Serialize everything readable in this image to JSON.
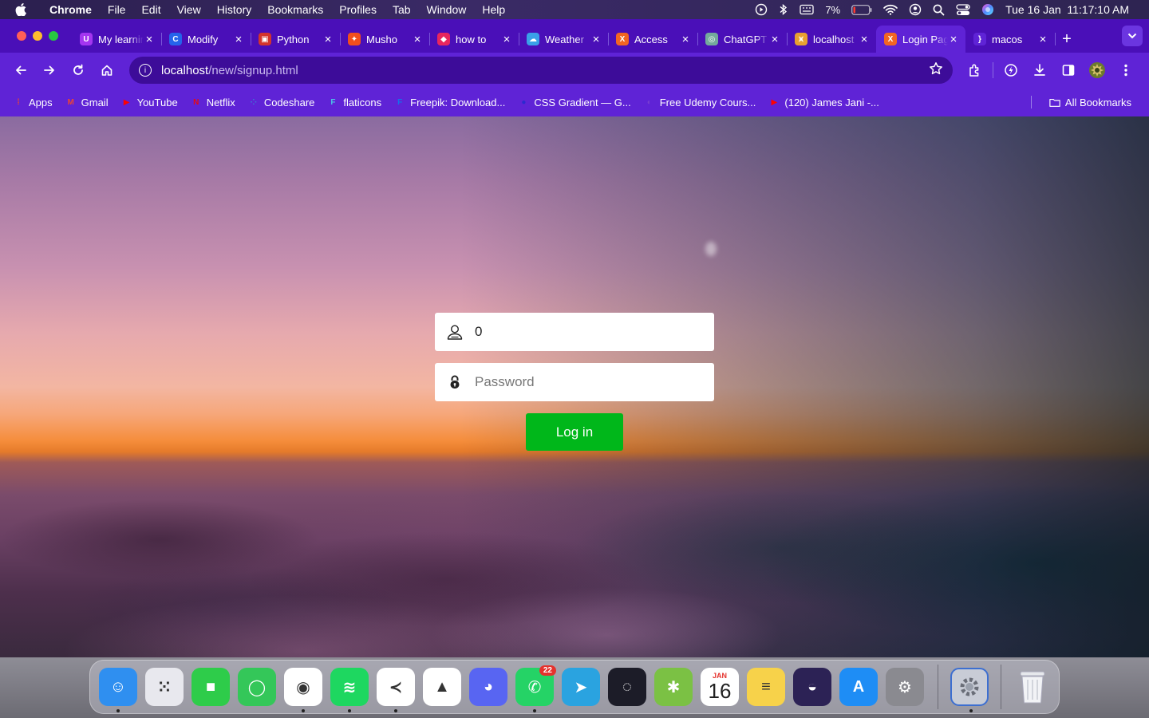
{
  "menubar": {
    "app_name": "Chrome",
    "items": [
      "File",
      "Edit",
      "View",
      "History",
      "Bookmarks",
      "Profiles",
      "Tab",
      "Window",
      "Help"
    ],
    "battery": "7%",
    "clock": "Tue 16 Jan  11:17:10 AM"
  },
  "tabs": [
    {
      "title": "My learning",
      "favicon_color": "#a435f0",
      "favicon_glyph": "U"
    },
    {
      "title": "Modify",
      "favicon_color": "#2563eb",
      "favicon_glyph": "C"
    },
    {
      "title": "Python",
      "favicon_color": "#d4342c",
      "favicon_glyph": "▣"
    },
    {
      "title": "Musho",
      "favicon_color": "#f24e1e",
      "favicon_glyph": "✦"
    },
    {
      "title": "how to",
      "favicon_color": "#e8265e",
      "favicon_glyph": "◆"
    },
    {
      "title": "Weather",
      "favicon_color": "#3aa0e8",
      "favicon_glyph": "☁"
    },
    {
      "title": "Access",
      "favicon_color": "#f26522",
      "favicon_glyph": "X"
    },
    {
      "title": "ChatGPT",
      "favicon_color": "#74aa9c",
      "favicon_glyph": "◎"
    },
    {
      "title": "localhost",
      "favicon_color": "#e8a030",
      "favicon_glyph": "⩙"
    },
    {
      "title": "Login Page",
      "favicon_color": "#f26522",
      "favicon_glyph": "X",
      "active": true
    },
    {
      "title": "macos",
      "favicon_color": "#5f23d6",
      "favicon_glyph": "}"
    }
  ],
  "address_bar": {
    "host": "localhost",
    "path": "/new/signup.html"
  },
  "bookmarks": [
    {
      "label": "Apps",
      "icon_color": "#ea4335",
      "glyph": "⁞"
    },
    {
      "label": "Gmail",
      "icon_color": "#ea4335",
      "glyph": "M"
    },
    {
      "label": "YouTube",
      "icon_color": "#ff0000",
      "glyph": "▶"
    },
    {
      "label": "Netflix",
      "icon_color": "#e50914",
      "glyph": "N"
    },
    {
      "label": "Codeshare",
      "icon_color": "#3a7bd5",
      "glyph": "⁘"
    },
    {
      "label": "flaticons",
      "icon_color": "#4cc3e8",
      "glyph": "F"
    },
    {
      "label": "Freepik: Download...",
      "icon_color": "#1273eb",
      "glyph": "F"
    },
    {
      "label": "CSS Gradient — G...",
      "icon_color": "#2a2ad0",
      "glyph": "●"
    },
    {
      "label": "Free Udemy Cours...",
      "icon_color": "#7a3fd0",
      "glyph": "◐"
    },
    {
      "label": "(120) James Jani -...",
      "icon_color": "#ff0000",
      "glyph": "▶"
    }
  ],
  "all_bookmarks_label": "All Bookmarks",
  "login": {
    "username_value": "0",
    "password_placeholder": "Password",
    "submit_label": "Log in"
  },
  "dock": {
    "whatsapp_badge": "22",
    "calendar_month": "JAN",
    "calendar_day": "16",
    "apps": [
      {
        "name": "finder-icon",
        "color": "#2f8ff0",
        "glyph": "☺",
        "running": true
      },
      {
        "name": "launchpad-icon",
        "color": "#e8e8ee",
        "glyph": "⁙",
        "running": false
      },
      {
        "name": "facetime-icon",
        "color": "#2ecc4a",
        "glyph": "■",
        "running": false
      },
      {
        "name": "messages-icon",
        "color": "#34c759",
        "glyph": "◯",
        "running": false
      },
      {
        "name": "chrome-icon",
        "color": "#ffffff",
        "glyph": "◉",
        "running": true
      },
      {
        "name": "spotify-icon",
        "color": "#1ed760",
        "glyph": "≋",
        "running": true
      },
      {
        "name": "vscode-icon",
        "color": "#ffffff",
        "glyph": "≺",
        "running": true
      },
      {
        "name": "google-drive-icon",
        "color": "#ffffff",
        "glyph": "▲",
        "running": false
      },
      {
        "name": "discord-icon",
        "color": "#5865f2",
        "glyph": "◕",
        "running": false
      },
      {
        "name": "whatsapp-icon",
        "color": "#25d366",
        "glyph": "✆",
        "running": true
      },
      {
        "name": "telegram-icon",
        "color": "#2aa3e0",
        "glyph": "➤",
        "running": false
      },
      {
        "name": "obs-icon",
        "color": "#1c1c28",
        "glyph": "◌",
        "running": false
      },
      {
        "name": "android-studio-icon",
        "color": "#7bc144",
        "glyph": "✱",
        "running": false
      },
      {
        "name": "calendar-icon",
        "color": "#ffffff",
        "glyph": "",
        "running": false
      },
      {
        "name": "notes-icon",
        "color": "#f7d24a",
        "glyph": "≡",
        "running": false
      },
      {
        "name": "eclipse-icon",
        "color": "#2c2255",
        "glyph": "◒",
        "running": false
      },
      {
        "name": "app-store-icon",
        "color": "#1e8df5",
        "glyph": "A",
        "running": false
      },
      {
        "name": "system-settings-icon",
        "color": "#8a8a90",
        "glyph": "⚙",
        "running": false
      }
    ]
  }
}
